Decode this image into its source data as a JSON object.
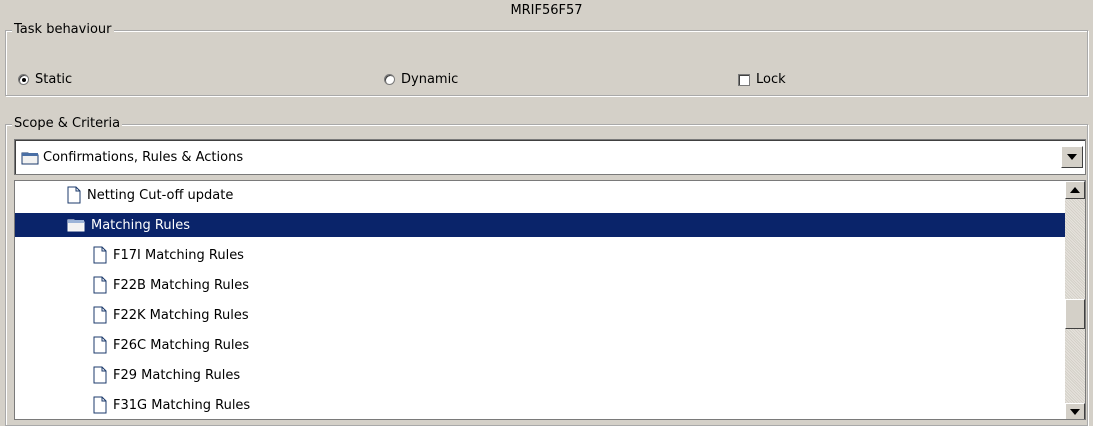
{
  "window": {
    "title": "MRIF56F57"
  },
  "task_behaviour": {
    "legend": "Task behaviour",
    "options": [
      {
        "label": "Static",
        "checked": true
      },
      {
        "label": "Dynamic",
        "checked": false
      }
    ],
    "lock": {
      "label": "Lock",
      "checked": false
    }
  },
  "scope": {
    "legend": "Scope & Criteria",
    "combo_value": "Confirmations, Rules & Actions",
    "combo_icon": "folder-icon",
    "tree": [
      {
        "label": "Netting Cut-off update",
        "icon": "document-icon",
        "level": 1,
        "selected": false
      },
      {
        "label": "Matching Rules",
        "icon": "folder-icon",
        "level": 1,
        "selected": true
      },
      {
        "label": "F17I Matching Rules",
        "icon": "document-icon",
        "level": 2,
        "selected": false
      },
      {
        "label": "F22B Matching Rules",
        "icon": "document-icon",
        "level": 2,
        "selected": false
      },
      {
        "label": "F22K Matching Rules",
        "icon": "document-icon",
        "level": 2,
        "selected": false
      },
      {
        "label": "F26C Matching Rules",
        "icon": "document-icon",
        "level": 2,
        "selected": false
      },
      {
        "label": "F29 Matching Rules",
        "icon": "document-icon",
        "level": 2,
        "selected": false
      },
      {
        "label": "F31G Matching Rules",
        "icon": "document-icon",
        "level": 2,
        "selected": false
      }
    ]
  },
  "colors": {
    "panel": "#d4d0c8",
    "selection": "#0a246a"
  }
}
